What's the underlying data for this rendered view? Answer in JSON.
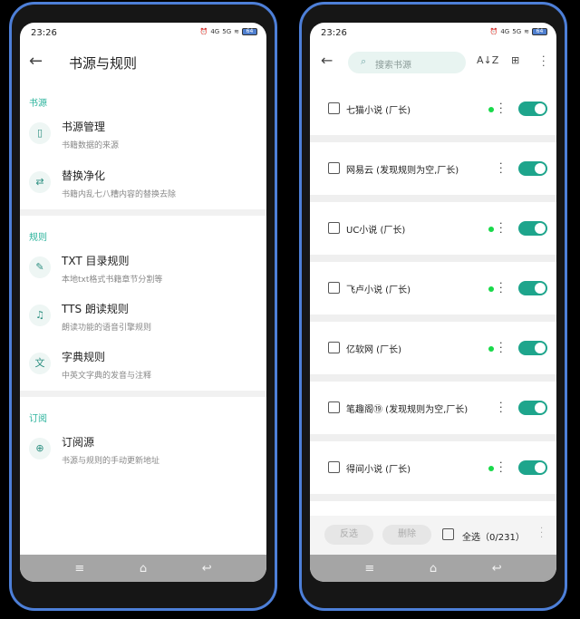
{
  "status": {
    "time": "23:26",
    "battery": "64",
    "net_left": "4G",
    "net_right": "5G"
  },
  "left": {
    "title": "书源与规则",
    "sections": [
      {
        "label": "书源",
        "items": [
          {
            "icon": "book-icon",
            "glyph": "▯",
            "title": "书源管理",
            "subtitle": "书籍数据的来源"
          },
          {
            "icon": "replace-icon",
            "glyph": "⇄",
            "title": "替换净化",
            "subtitle": "书籍内乱七八糟内容的替换去除"
          }
        ]
      },
      {
        "label": "规则",
        "items": [
          {
            "icon": "toc-icon",
            "glyph": "✎",
            "title": "TXT 目录规则",
            "subtitle": "本地txt格式书籍章节分割等"
          },
          {
            "icon": "headphones-icon",
            "glyph": "♫",
            "title": "TTS 朗读规则",
            "subtitle": "朗读功能的语音引擎规则"
          },
          {
            "icon": "translate-icon",
            "glyph": "文",
            "title": "字典规则",
            "subtitle": "中英文字典的发音与注释"
          }
        ]
      },
      {
        "label": "订阅",
        "items": [
          {
            "icon": "globe-icon",
            "glyph": "⊕",
            "title": "订阅源",
            "subtitle": "书源与规则的手动更新地址"
          }
        ]
      }
    ]
  },
  "right": {
    "search_placeholder": "搜索书源",
    "sources": [
      {
        "name": "七猫小说 (厂长)",
        "dot": true
      },
      {
        "name": "网易云 (发现规则为空,厂长)",
        "dot": false
      },
      {
        "name": "UC小说 (厂长)",
        "dot": true
      },
      {
        "name": "飞卢小说 (厂长)",
        "dot": true
      },
      {
        "name": "亿软网 (厂长)",
        "dot": true
      },
      {
        "name": "笔趣阁⑲ (发现规则为空,厂长)",
        "dot": false
      },
      {
        "name": "得间小说 (厂长)",
        "dot": true
      }
    ],
    "bottom": {
      "invert_label": "反选",
      "delete_label": "删除",
      "select_all_label": "全选（0/231）"
    }
  },
  "colors": {
    "accent": "#1ea58c",
    "frame": "#4d7fd8"
  }
}
